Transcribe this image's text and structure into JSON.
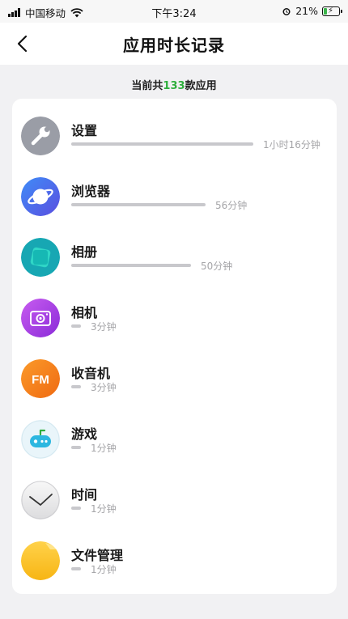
{
  "status_bar": {
    "carrier": "中国移动",
    "time": "下午3:24",
    "battery": "21%",
    "battery_level": 0.21
  },
  "header": {
    "title": "应用时长记录",
    "back_icon": "chevron-left-icon"
  },
  "summary": {
    "prefix": "当前共",
    "count": "133",
    "suffix": "款应用",
    "count_color": "#2fae3d"
  },
  "apps": [
    {
      "name": "设置",
      "duration": "1小时16分钟",
      "minutes": 76,
      "icon": "wrench-icon"
    },
    {
      "name": "浏览器",
      "duration": "56分钟",
      "minutes": 56,
      "icon": "planet-icon"
    },
    {
      "name": "相册",
      "duration": "50分钟",
      "minutes": 50,
      "icon": "gallery-icon"
    },
    {
      "name": "相机",
      "duration": "3分钟",
      "minutes": 3,
      "icon": "camera-icon"
    },
    {
      "name": "收音机",
      "duration": "3分钟",
      "minutes": 3,
      "icon": "radio-fm-icon",
      "icon_text": "FM"
    },
    {
      "name": "游戏",
      "duration": "1分钟",
      "minutes": 1,
      "icon": "gamepad-icon"
    },
    {
      "name": "时间",
      "duration": "1分钟",
      "minutes": 1,
      "icon": "clock-icon"
    },
    {
      "name": "文件管理",
      "duration": "1分钟",
      "minutes": 1,
      "icon": "folder-icon"
    }
  ]
}
